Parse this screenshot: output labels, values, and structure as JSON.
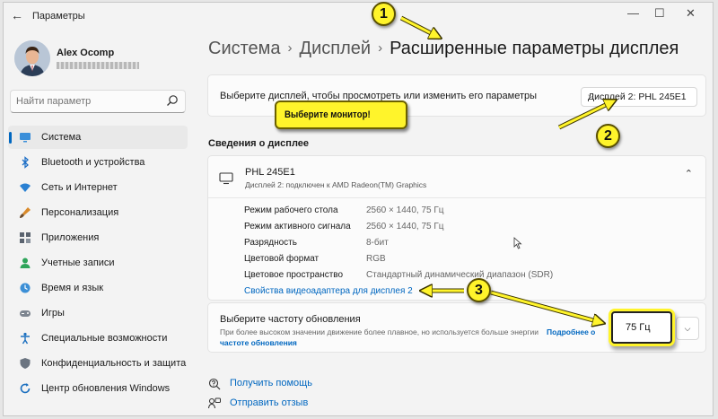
{
  "app": {
    "title": "Параметры",
    "back_glyph": "←"
  },
  "window_controls": {
    "minimize": "—",
    "maximize": "☐",
    "close": "✕"
  },
  "user": {
    "name": "Alex Ocomp"
  },
  "search": {
    "placeholder": "Найти параметр"
  },
  "sidebar": {
    "items": [
      {
        "label": "Система",
        "icon": "monitor-icon"
      },
      {
        "label": "Bluetooth и устройства",
        "icon": "bluetooth-icon"
      },
      {
        "label": "Сеть и Интернет",
        "icon": "wifi-icon"
      },
      {
        "label": "Персонализация",
        "icon": "brush-icon"
      },
      {
        "label": "Приложения",
        "icon": "apps-icon"
      },
      {
        "label": "Учетные записи",
        "icon": "person-icon"
      },
      {
        "label": "Время и язык",
        "icon": "globe-clock-icon"
      },
      {
        "label": "Игры",
        "icon": "gamepad-icon"
      },
      {
        "label": "Специальные возможности",
        "icon": "accessibility-icon"
      },
      {
        "label": "Конфиденциальность и защита",
        "icon": "shield-icon"
      },
      {
        "label": "Центр обновления Windows",
        "icon": "update-icon"
      }
    ]
  },
  "breadcrumb": {
    "part1": "Система",
    "part2": "Дисплей",
    "current": "Расширенные параметры дисплея",
    "separator": "›"
  },
  "display_select": {
    "prompt": "Выберите дисплей, чтобы просмотреть или изменить его параметры",
    "value": "Дисплей 2: PHL 245E1",
    "chevron": "⌵"
  },
  "info": {
    "section_title": "Сведения о дисплее",
    "monitor_name": "PHL 245E1",
    "monitor_sub": "Дисплей 2: подключен к AMD Radeon(TM) Graphics",
    "collapse_glyph": "⌃",
    "rows": [
      {
        "label": "Режим рабочего стола",
        "value": "2560 × 1440, 75 Гц"
      },
      {
        "label": "Режим активного сигнала",
        "value": "2560 × 1440, 75 Гц"
      },
      {
        "label": "Разрядность",
        "value": "8-бит"
      },
      {
        "label": "Цветовой формат",
        "value": "RGB"
      },
      {
        "label": "Цветовое пространство",
        "value": "Стандартный динамический диапазон (SDR)"
      }
    ],
    "adapter_link": "Свойства видеоадаптера для дисплея 2"
  },
  "refresh": {
    "title": "Выберите частоту обновления",
    "desc": "При более высоком значении движение более плавное, но используется больше энергии",
    "link_part1": "Подробнее о",
    "link_part2": "частоте обновления",
    "value": "75 Гц",
    "chevron": "⌵"
  },
  "footer": {
    "help": "Получить помощь",
    "feedback": "Отправить отзыв"
  },
  "annotations": {
    "callout": "Выберите монитор!",
    "n1": "1",
    "n2": "2",
    "n3": "3"
  },
  "colors": {
    "accent": "#0067c0",
    "callout": "#fff42b",
    "arrow": "#fff42b"
  }
}
